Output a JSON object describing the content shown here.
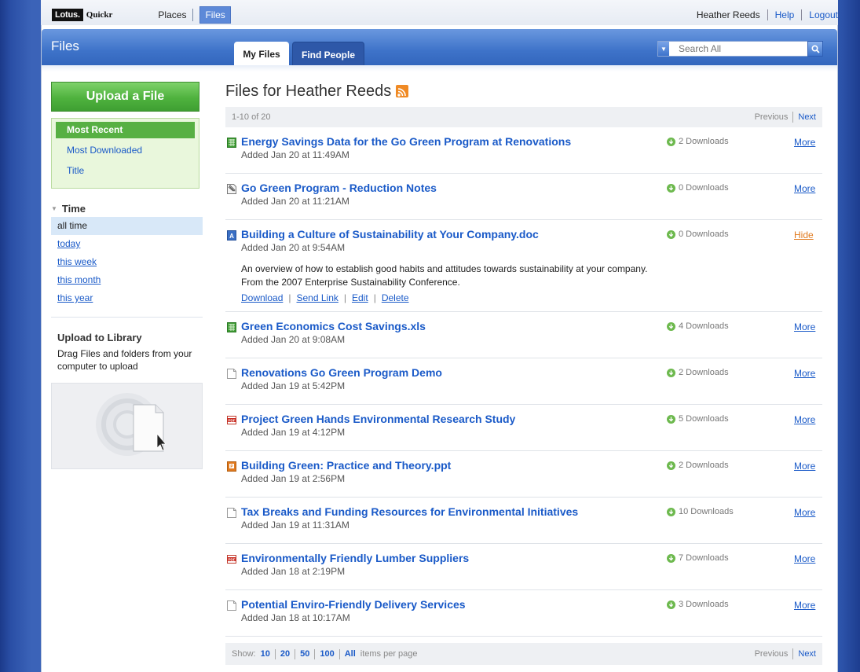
{
  "topnav": {
    "logo_lotus": "Lotus.",
    "logo_quickr": "Quickr",
    "places": "Places",
    "files": "Files",
    "user": "Heather Reeds",
    "help": "Help",
    "logout": "Logout"
  },
  "header": {
    "title": "Files",
    "tabs": [
      {
        "label": "My Files",
        "active": true
      },
      {
        "label": "Find People",
        "active": false
      }
    ],
    "search_placeholder": "Search All"
  },
  "sidebar": {
    "upload_label": "Upload a File",
    "sort_items": [
      {
        "label": "Most Recent",
        "selected": true
      },
      {
        "label": "Most Downloaded",
        "selected": false
      },
      {
        "label": "Title",
        "selected": false
      }
    ],
    "time_heading": "Time",
    "time_items": [
      {
        "label": "all time",
        "selected": true
      },
      {
        "label": "today",
        "selected": false
      },
      {
        "label": "this week",
        "selected": false
      },
      {
        "label": "this month",
        "selected": false
      },
      {
        "label": "this year",
        "selected": false
      }
    ],
    "library_heading": "Upload to Library",
    "library_text": "Drag Files and folders from your computer to upload"
  },
  "main": {
    "title": "Files for Heather Reeds",
    "range": "1-10 of 20",
    "previous": "Previous",
    "next": "Next",
    "files": [
      {
        "icon": "spreadsheet-icon",
        "title": "Energy Savings Data for the Go Green Program at Renovations",
        "added": "Added Jan 20 at 11:49AM",
        "downloads": "2 Downloads",
        "action": "More"
      },
      {
        "icon": "note-icon",
        "title": "Go Green Program - Reduction Notes",
        "added": "Added Jan 20 at 11:21AM",
        "downloads": "0 Downloads",
        "action": "More"
      },
      {
        "icon": "word-doc-icon",
        "title": "Building a Culture of Sustainability at Your Company.doc",
        "added": "Added Jan 20 at 9:54AM",
        "downloads": "0 Downloads",
        "action": "Hide",
        "description": "An overview of how to establish good habits and attitudes towards sustainability at your company. From the 2007 Enterprise Sustainability Conference.",
        "actions": [
          "Download",
          "Send Link",
          "Edit",
          "Delete"
        ]
      },
      {
        "icon": "spreadsheet-icon",
        "title": "Green Economics Cost Savings.xls",
        "added": "Added Jan 20 at 9:08AM",
        "downloads": "4 Downloads",
        "action": "More"
      },
      {
        "icon": "blank-file-icon",
        "title": "Renovations Go Green Program Demo",
        "added": "Added Jan 19 at 5:42PM",
        "downloads": "2 Downloads",
        "action": "More"
      },
      {
        "icon": "pdf-icon",
        "title": "Project Green Hands Environmental Research Study",
        "added": "Added Jan 19 at 4:12PM",
        "downloads": "5 Downloads",
        "action": "More"
      },
      {
        "icon": "presentation-icon",
        "title": "Building Green: Practice and Theory.ppt",
        "added": "Added Jan 19 at 2:56PM",
        "downloads": "2 Downloads",
        "action": "More"
      },
      {
        "icon": "blank-file-icon",
        "title": "Tax Breaks and Funding Resources for Environmental Initiatives",
        "added": "Added Jan 19 at 11:31AM",
        "downloads": "10 Downloads",
        "action": "More"
      },
      {
        "icon": "pdf-icon",
        "title": "Environmentally Friendly Lumber Suppliers",
        "added": "Added Jan 18 at 2:19PM",
        "downloads": "7 Downloads",
        "action": "More"
      },
      {
        "icon": "blank-file-icon",
        "title": "Potential Enviro-Friendly Delivery Services",
        "added": "Added Jan 18 at 10:17AM",
        "downloads": "3 Downloads",
        "action": "More"
      }
    ],
    "footer": {
      "show_label": "Show:",
      "per_page_options": [
        "10",
        "20",
        "50",
        "100",
        "All"
      ],
      "per_page_suffix": "items per page"
    }
  },
  "colors": {
    "accent_blue": "#1a5ac8",
    "upload_green": "#4fb23e",
    "hide_orange": "#e07a1f"
  }
}
